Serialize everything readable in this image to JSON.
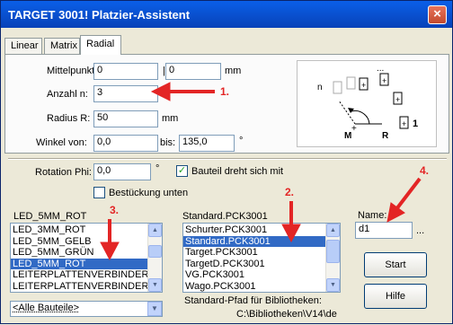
{
  "window": {
    "title": "TARGET 3001! Platzier-Assistent",
    "close_glyph": "×"
  },
  "tabs": [
    {
      "label": "Linear",
      "active": false
    },
    {
      "label": "Matrix",
      "active": false
    },
    {
      "label": "Radial",
      "active": true
    }
  ],
  "radial": {
    "mittelpunkt_label": "Mittelpunkt  M:",
    "mittelpunkt_x": "0",
    "separator": "|",
    "mittelpunkt_y": "0",
    "mittelpunkt_unit": "mm",
    "anzahl_label": "Anzahl  n:",
    "anzahl_value": "3",
    "radius_label": "Radius R:",
    "radius_value": "50",
    "radius_unit": "mm",
    "winkel_label": "Winkel von:",
    "winkel_from": "0,0",
    "bis_label": "bis:",
    "winkel_to": "135,0",
    "winkel_unit": "°"
  },
  "diagram": {
    "n_label": "n",
    "m_label": "M",
    "r_label": "R",
    "one_label": "1",
    "dots_label": "...",
    "plus_glyph": "+"
  },
  "options": {
    "rotation_label": "Rotation Phi:",
    "rotation_value": "0,0",
    "rotation_unit": "°",
    "bauteil_dreht_label": "Bauteil dreht sich mit",
    "bauteil_dreht_checked": true,
    "bestueckung_label": "Bestückung unten",
    "bestueckung_checked": false,
    "check_glyph": "✓"
  },
  "parts": {
    "header": "LED_5MM_ROT",
    "items": [
      "LED_3MM_ROT",
      "LED_5MM_GELB",
      "LED_5MM_GRÜN",
      "LED_5MM_ROT",
      "LEITERPLATTENVERBINDER",
      "LEITERPLATTENVERBINDER"
    ],
    "selected_index": 3,
    "filter_value": "<Alle Bauteile>"
  },
  "library": {
    "header": "Standard.PCK3001",
    "items": [
      "Schurter.PCK3001",
      "Standard.PCK3001",
      "Target.PCK3001",
      "TargetD.PCK3001",
      "VG.PCK3001",
      "Wago.PCK3001"
    ],
    "selected_index": 1,
    "path_label": "Standard-Pfad für Bibliotheken:",
    "path_value": "C:\\Bibliotheken\\V14\\de"
  },
  "name": {
    "label": "Name:",
    "value": "d1",
    "ellipsis": "..."
  },
  "buttons": {
    "start_label": "Start",
    "hilfe_label": "Hilfe"
  },
  "annotations": {
    "one": "1.",
    "two": "2.",
    "three": "3.",
    "four": "4.",
    "color": "#e32525"
  },
  "icons": {
    "scroll_up": "▲",
    "scroll_down": "▼"
  }
}
